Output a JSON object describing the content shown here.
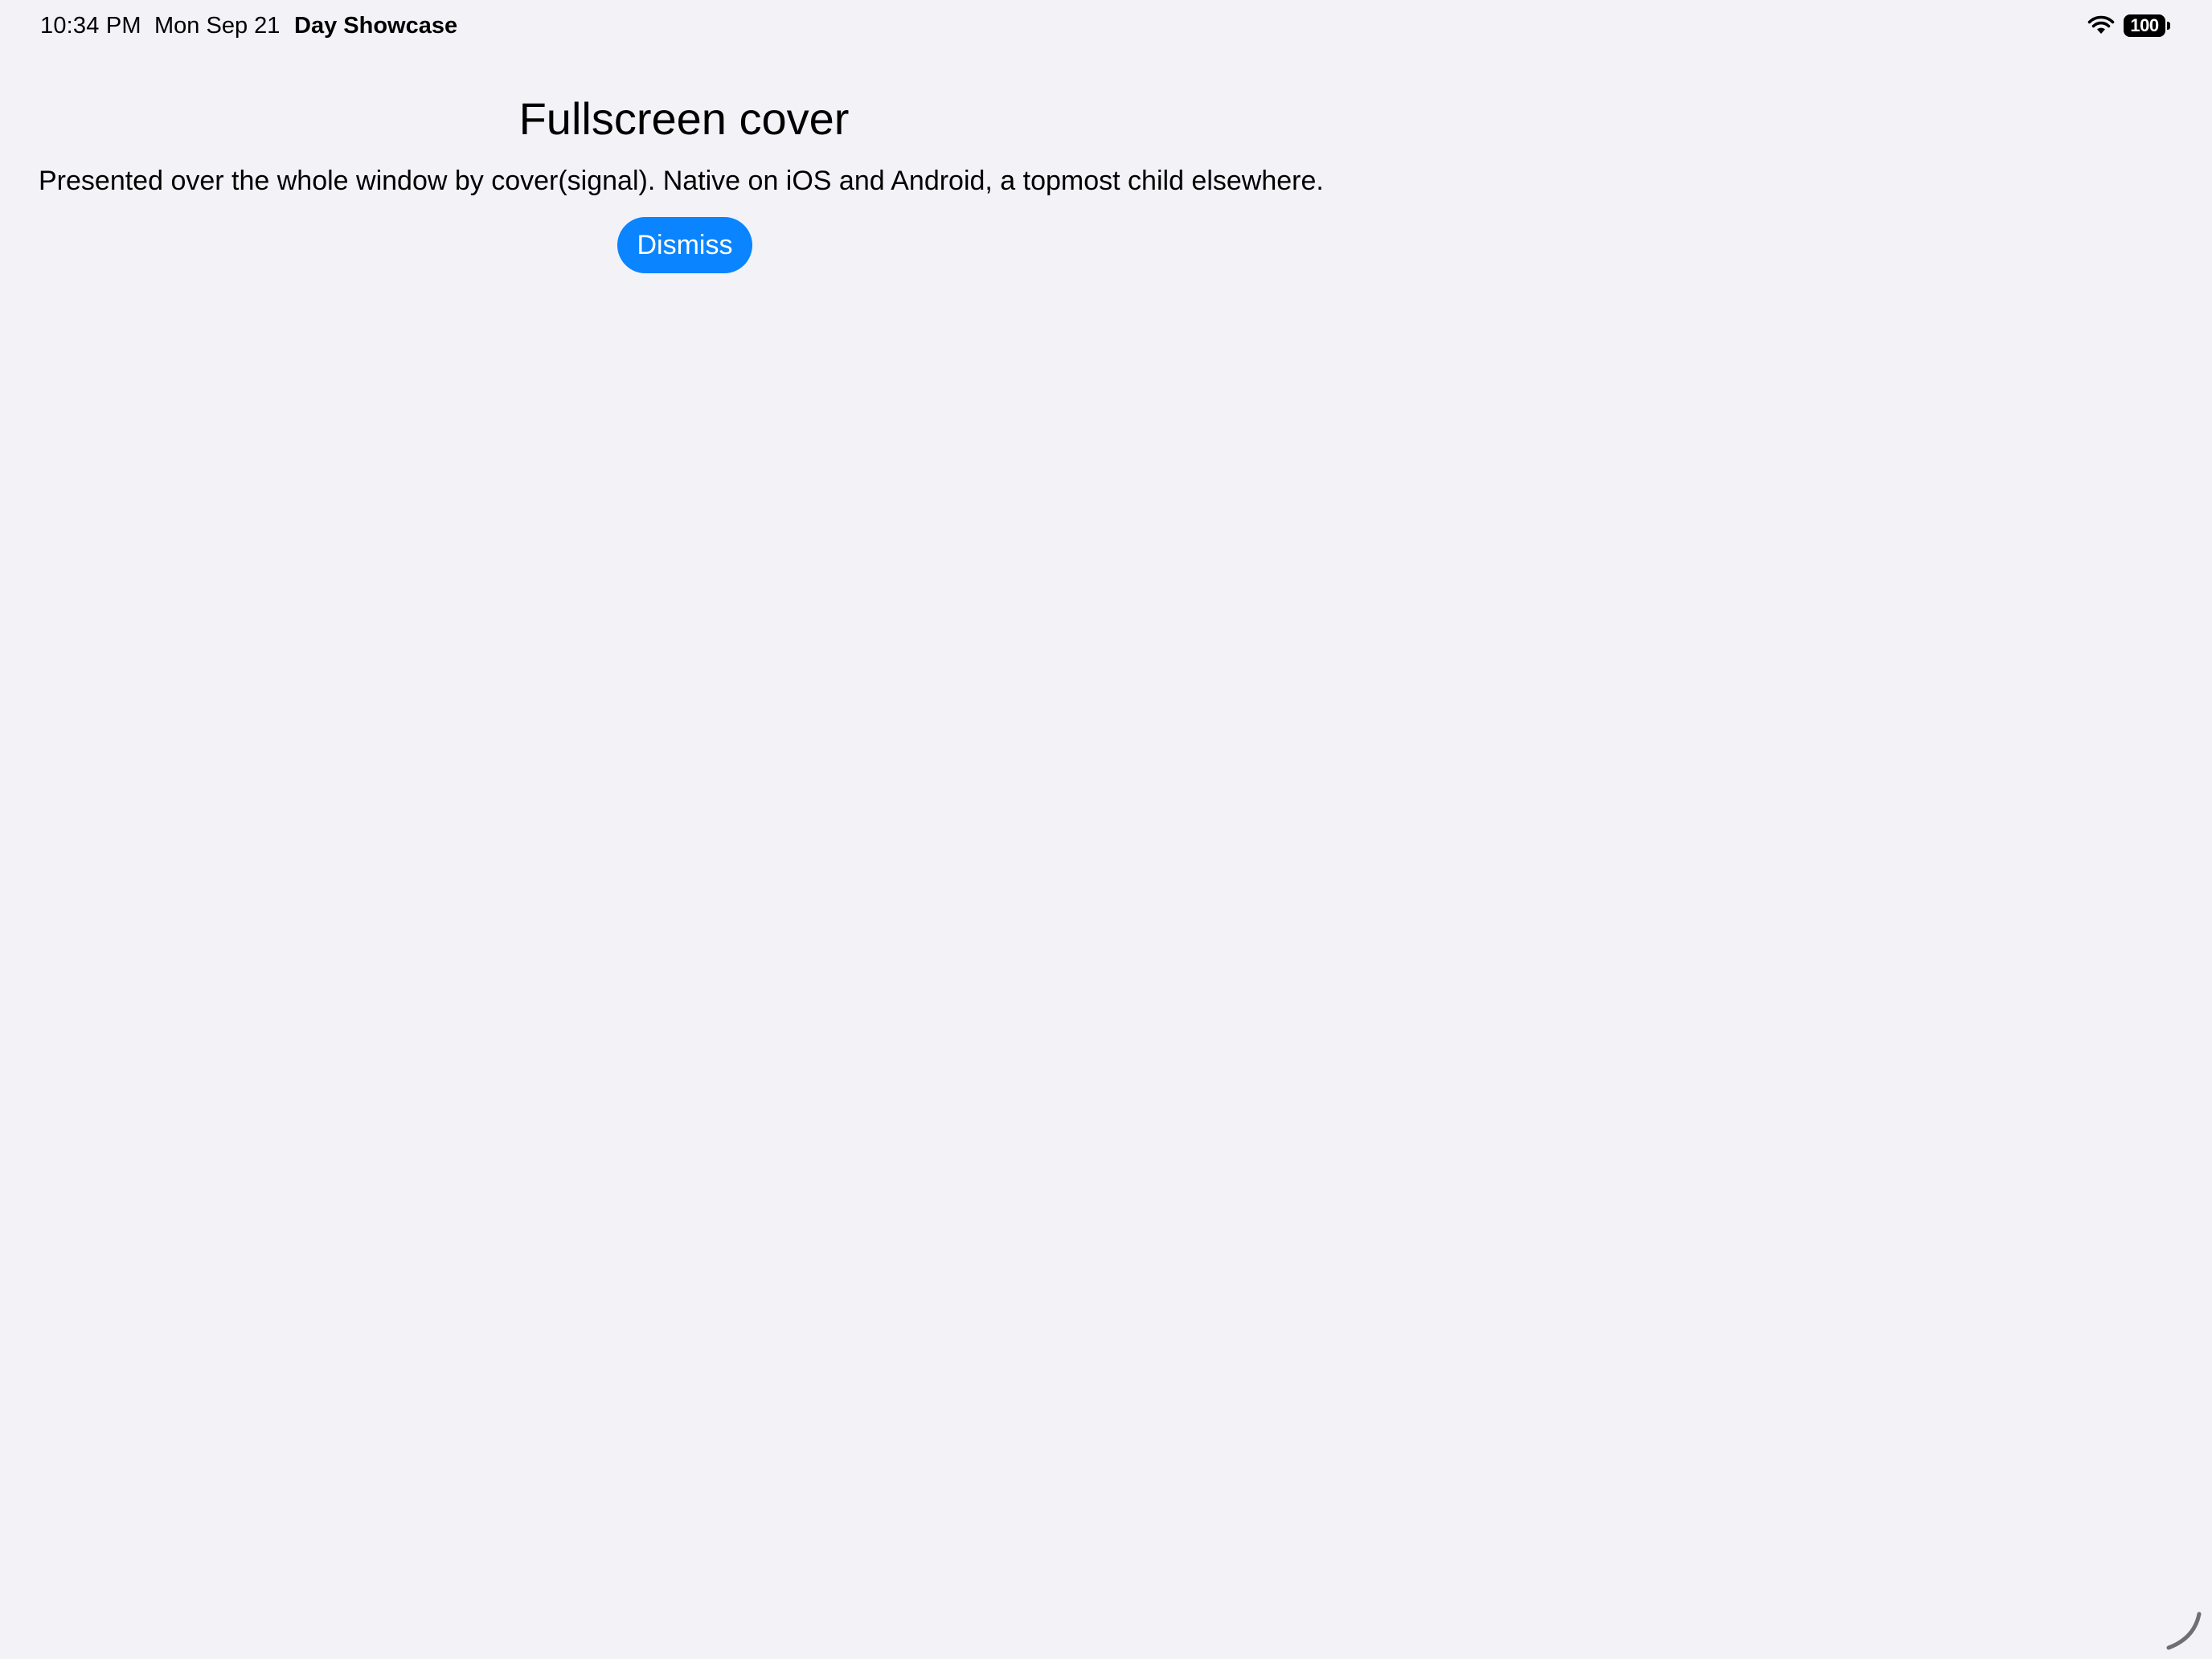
{
  "status_bar": {
    "time": "10:34 PM",
    "date": "Mon Sep 21",
    "app_name": "Day Showcase",
    "wifi_icon": "wifi-icon",
    "battery_level": "100"
  },
  "cover": {
    "title": "Fullscreen cover",
    "description": "Presented over the whole window by cover(signal). Native on iOS and Android, a topmost child elsewhere.",
    "dismiss_label": "Dismiss"
  },
  "colors": {
    "background": "#f2f2f7",
    "accent": "#0a84ff",
    "text": "#000000"
  },
  "icons": {
    "resize": "window-resize-handle-icon"
  }
}
